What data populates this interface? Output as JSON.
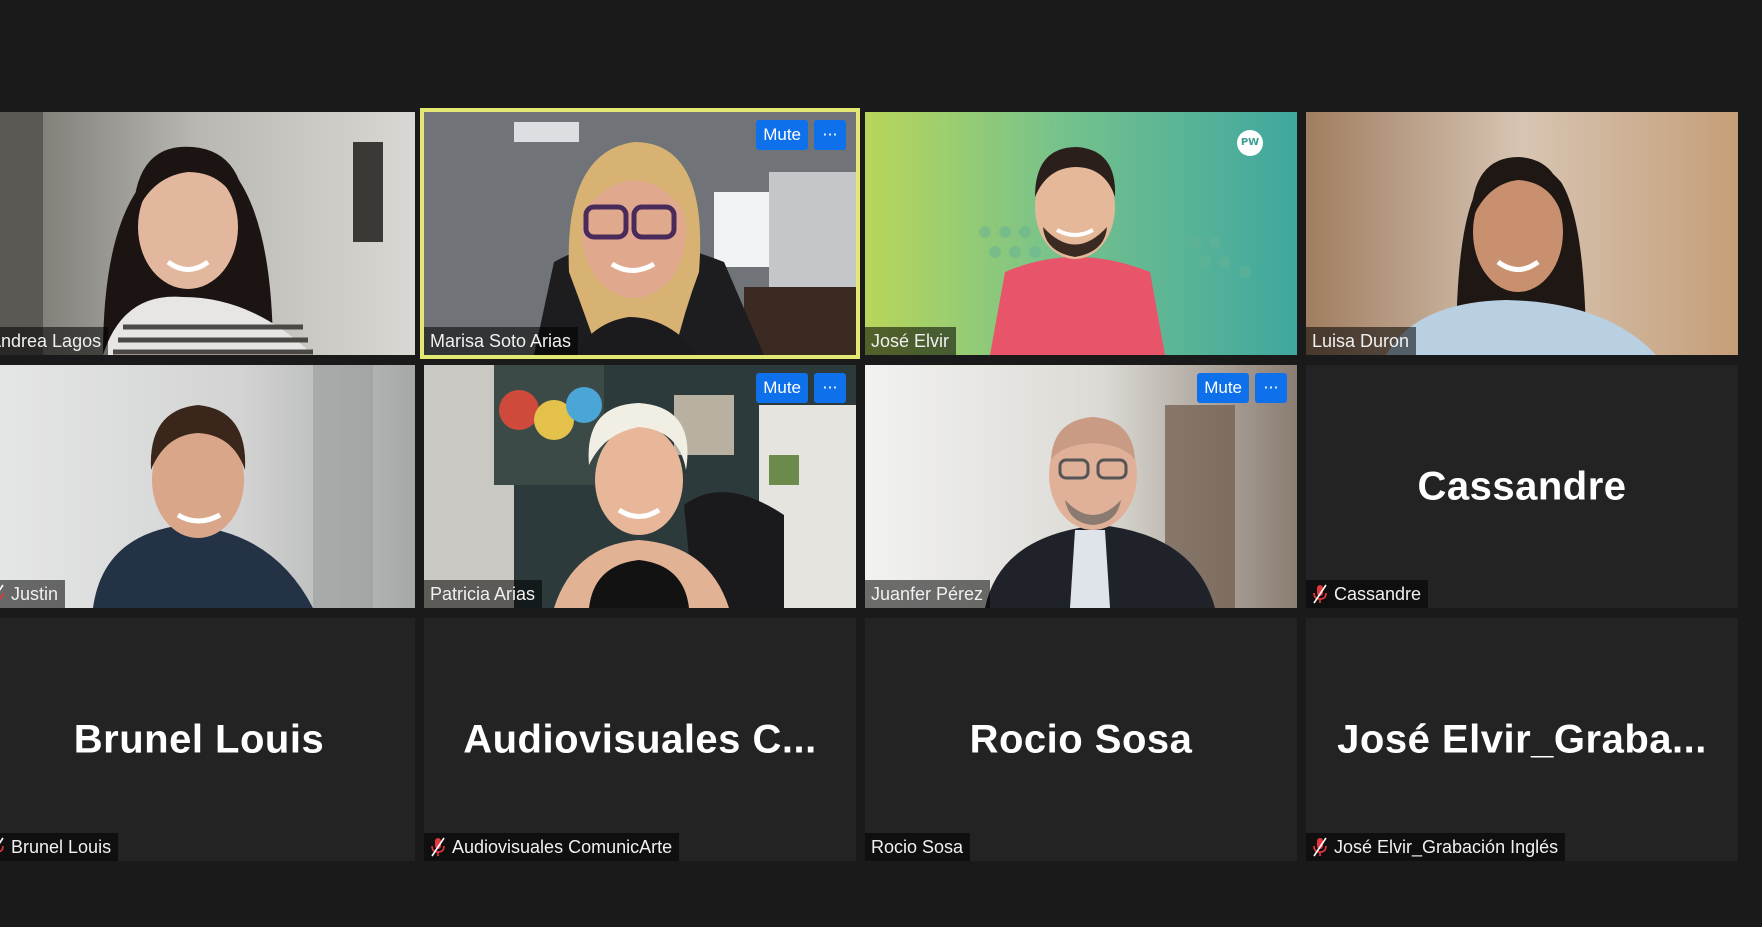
{
  "meeting": {
    "participants": [
      {
        "id": "andrea",
        "label": "Andrea Lagos",
        "video": true,
        "muted": false,
        "active": false
      },
      {
        "id": "marisa",
        "label": "Marisa Soto Arias",
        "video": true,
        "muted": false,
        "active": true,
        "controls": true
      },
      {
        "id": "jose",
        "label": "José Elvir",
        "video": true,
        "muted": false,
        "active": false,
        "logo": "PW"
      },
      {
        "id": "luisa",
        "label": "Luisa Duron",
        "video": true,
        "muted": false,
        "active": false
      },
      {
        "id": "justin",
        "label": "Justin",
        "video": true,
        "muted": true,
        "active": false
      },
      {
        "id": "patricia",
        "label": "Patricia Arias",
        "video": true,
        "muted": false,
        "active": false,
        "controls": true
      },
      {
        "id": "juanfer",
        "label": "Juanfer Pérez",
        "video": true,
        "muted": false,
        "active": false,
        "controls": true
      },
      {
        "id": "cassandre",
        "label": "Cassandre",
        "display_name": "Cassandre",
        "video": false,
        "muted": true
      },
      {
        "id": "brunel",
        "label": "Brunel Louis",
        "display_name": "Brunel Louis",
        "video": false,
        "muted": true
      },
      {
        "id": "audiovisuales",
        "label": "Audiovisuales ComunicArte",
        "display_name": "Audiovisuales  C...",
        "video": false,
        "muted": true
      },
      {
        "id": "rocio",
        "label": "Rocio Sosa",
        "display_name": "Rocio Sosa",
        "video": false,
        "muted": false
      },
      {
        "id": "jose2",
        "label": "José Elvir_Grabación Inglés",
        "display_name": "José  Elvir_Graba...",
        "video": false,
        "muted": true
      }
    ]
  },
  "controls": {
    "mute_label": "Mute",
    "more_label": "···"
  },
  "icons": {
    "muted_mic": "mic-muted-icon"
  },
  "colors": {
    "active_speaker_border": "#e3e873",
    "button_blue": "#0e71eb",
    "muted_red": "#e5363d",
    "background": "#1a1a1a",
    "tile_bg": "#232323"
  }
}
